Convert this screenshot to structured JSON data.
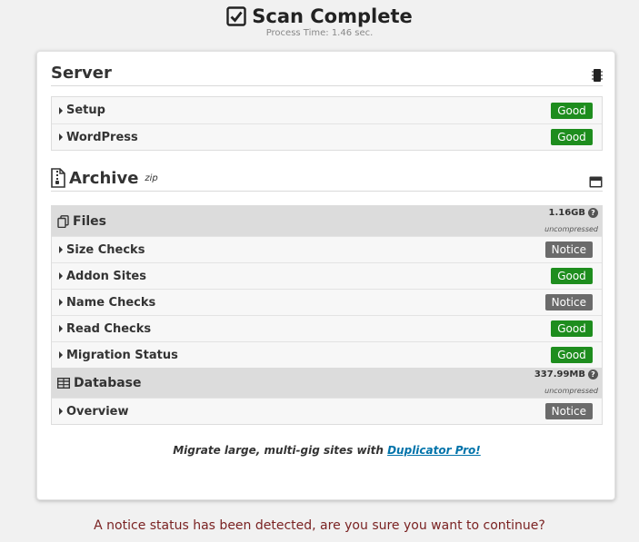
{
  "header": {
    "title": "Scan Complete",
    "subtitle": "Process Time: 1.46 sec."
  },
  "server": {
    "title": "Server",
    "rows": [
      {
        "label": "Setup",
        "status": "Good"
      },
      {
        "label": "WordPress",
        "status": "Good"
      }
    ]
  },
  "archive": {
    "title": "Archive",
    "format": "zip",
    "files": {
      "title": "Files",
      "size": "1.16GB",
      "size_note": "uncompressed",
      "rows": [
        {
          "label": "Size Checks",
          "status": "Notice"
        },
        {
          "label": "Addon Sites",
          "status": "Good"
        },
        {
          "label": "Name Checks",
          "status": "Notice"
        },
        {
          "label": "Read Checks",
          "status": "Good"
        },
        {
          "label": "Migration Status",
          "status": "Good"
        }
      ]
    },
    "database": {
      "title": "Database",
      "size": "337.99MB",
      "size_note": "uncompressed",
      "rows": [
        {
          "label": "Overview",
          "status": "Notice"
        }
      ]
    }
  },
  "promo": {
    "text": "Migrate large, multi-gig sites with ",
    "link": "Duplicator Pro!"
  },
  "footer": {
    "warning": "A notice status has been detected, are you sure you want to continue?"
  },
  "colors": {
    "good": "#1e8d1e",
    "notice": "#6b6b6b",
    "link": "#0073aa",
    "warning": "#7a2222"
  }
}
